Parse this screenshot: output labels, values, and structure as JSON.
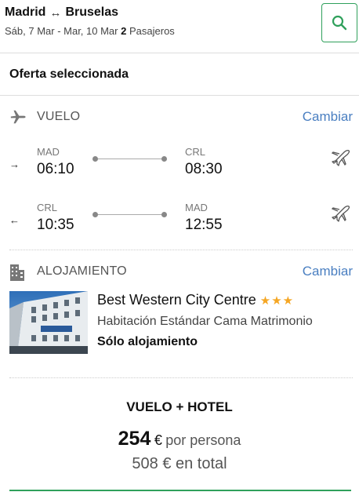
{
  "header": {
    "origin": "Madrid",
    "destination": "Bruselas",
    "dates": "Sáb, 7 Mar - Mar, 10 Mar",
    "passengers_count": "2",
    "passengers_label": "Pasajeros",
    "search_icon": "search-icon",
    "accent_color": "#2fa05b"
  },
  "section": {
    "title": "Oferta seleccionada"
  },
  "flight": {
    "label": "VUELO",
    "change_label": "Cambiar",
    "outbound": {
      "from_code": "MAD",
      "from_time": "06:10",
      "to_code": "CRL",
      "to_time": "08:30"
    },
    "inbound": {
      "from_code": "CRL",
      "from_time": "10:35",
      "to_code": "MAD",
      "to_time": "12:55"
    }
  },
  "accommodation": {
    "label": "ALOJAMIENTO",
    "change_label": "Cambiar",
    "hotel_name": "Best Western City Centre",
    "stars": "★★★",
    "star_rating": 3,
    "room": "Habitación Estándar Cama Matrimonio",
    "board": "Sólo alojamiento"
  },
  "package": {
    "title": "VUELO + HOTEL",
    "price_per_person": "254",
    "currency": "€",
    "per_person_label": "por persona",
    "total": "508 € en total"
  },
  "link_color": "#4a7fc1"
}
